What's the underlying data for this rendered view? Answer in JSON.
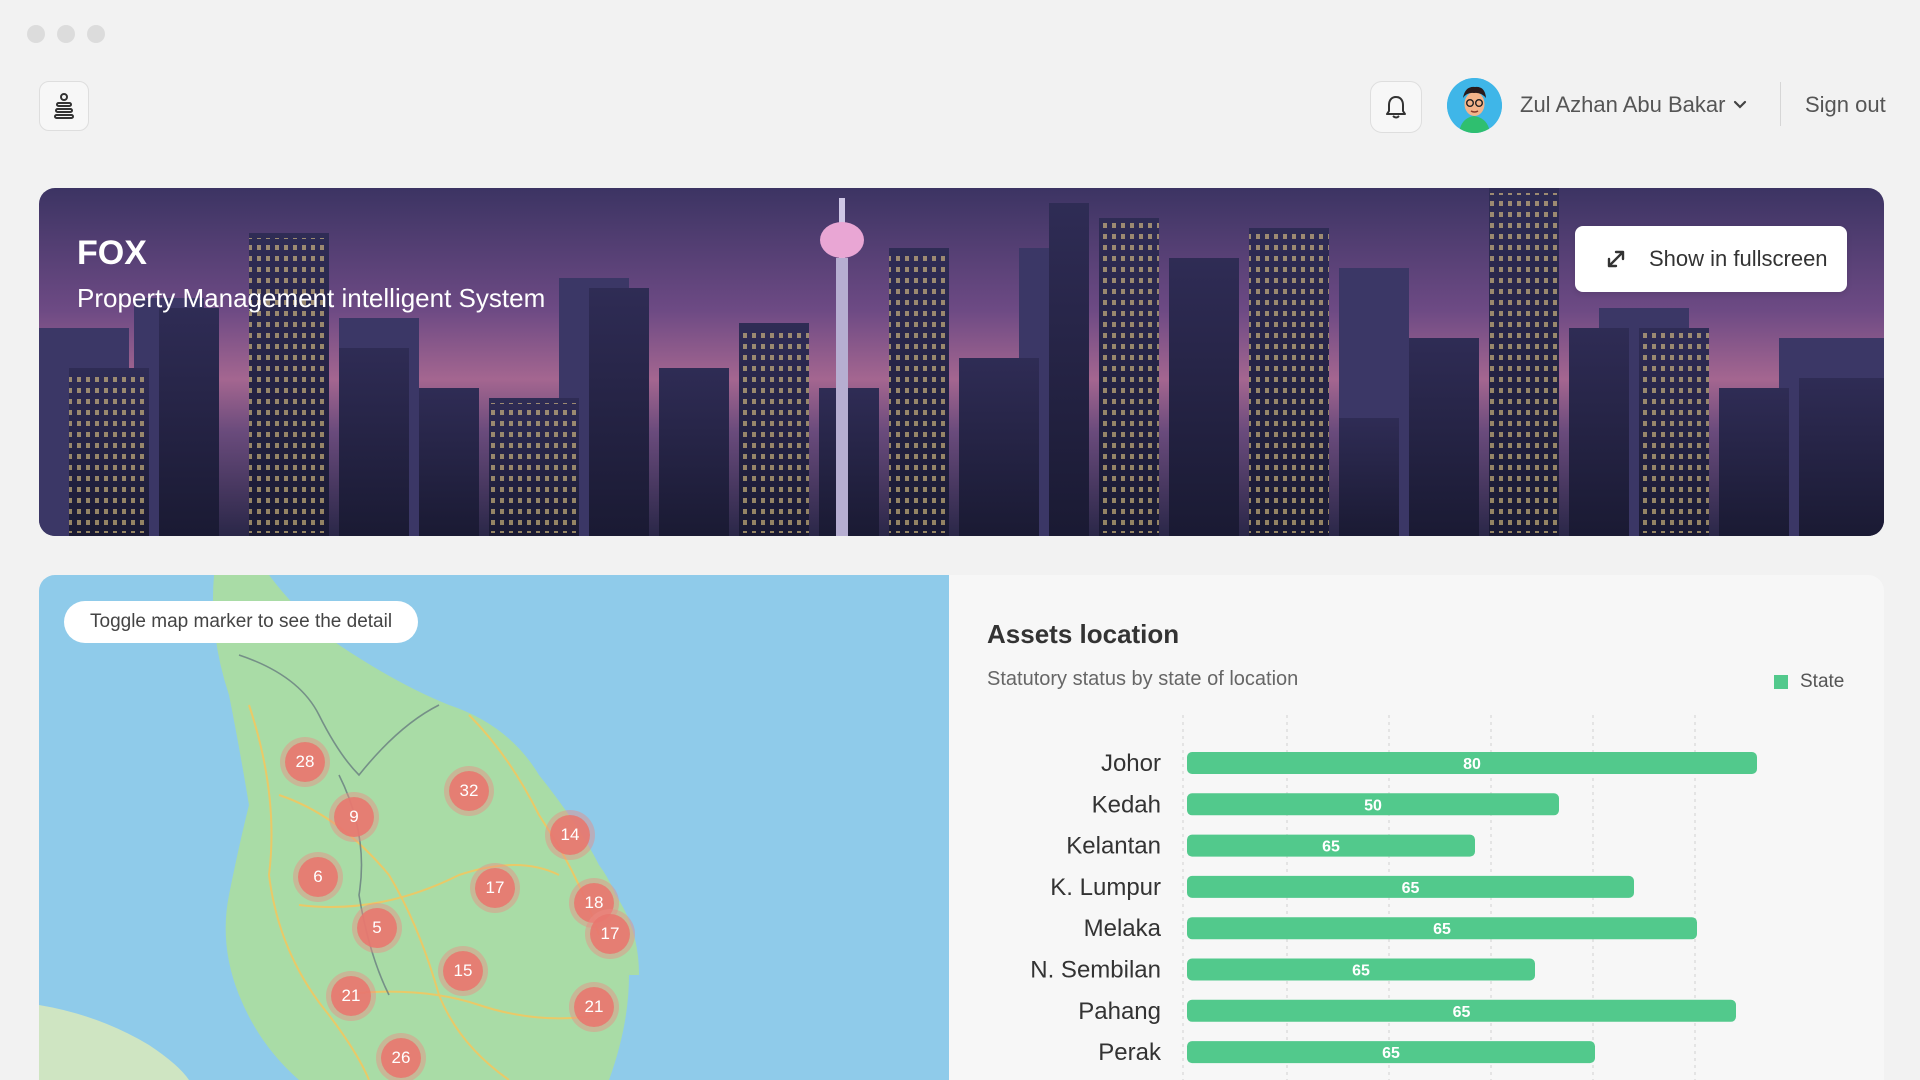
{
  "header": {
    "user_name": "Zul Azhan Abu Bakar",
    "signout_label": "Sign out",
    "icons": [
      "menu-icon",
      "bell-icon",
      "chevron-down-icon"
    ]
  },
  "hero": {
    "brand": "FOX",
    "subtitle": "Property Management intelligent System",
    "fullscreen_label": "Show in fullscreen"
  },
  "map": {
    "hint": "Toggle map marker to see the detail",
    "markers": [
      "28",
      "32",
      "9",
      "14",
      "6",
      "17",
      "18",
      "17",
      "5",
      "15",
      "21",
      "21",
      "26"
    ]
  },
  "colors": {
    "accent": "#52c98c",
    "marker": "#e87870",
    "sea": "#8fcbea",
    "land": "#a9dca6"
  },
  "chart_data": {
    "type": "bar",
    "title": "Assets location",
    "subtitle": "Statutory status by state of location",
    "orientation": "horizontal",
    "categories": [
      "Johor",
      "Kedah",
      "Kelantan",
      "K. Lumpur",
      "Melaka",
      "N. Sembilan",
      "Pahang",
      "Perak"
    ],
    "series": [
      {
        "name": "State",
        "values": [
          95,
          62,
          48,
          74.5,
          85,
          58,
          91.5,
          68
        ],
        "data_labels": [
          "80",
          "50",
          "65",
          "65",
          "65",
          "65",
          "65",
          "65"
        ]
      }
    ],
    "xlim": [
      0,
      100
    ],
    "grid": true,
    "legend": "top-right"
  }
}
